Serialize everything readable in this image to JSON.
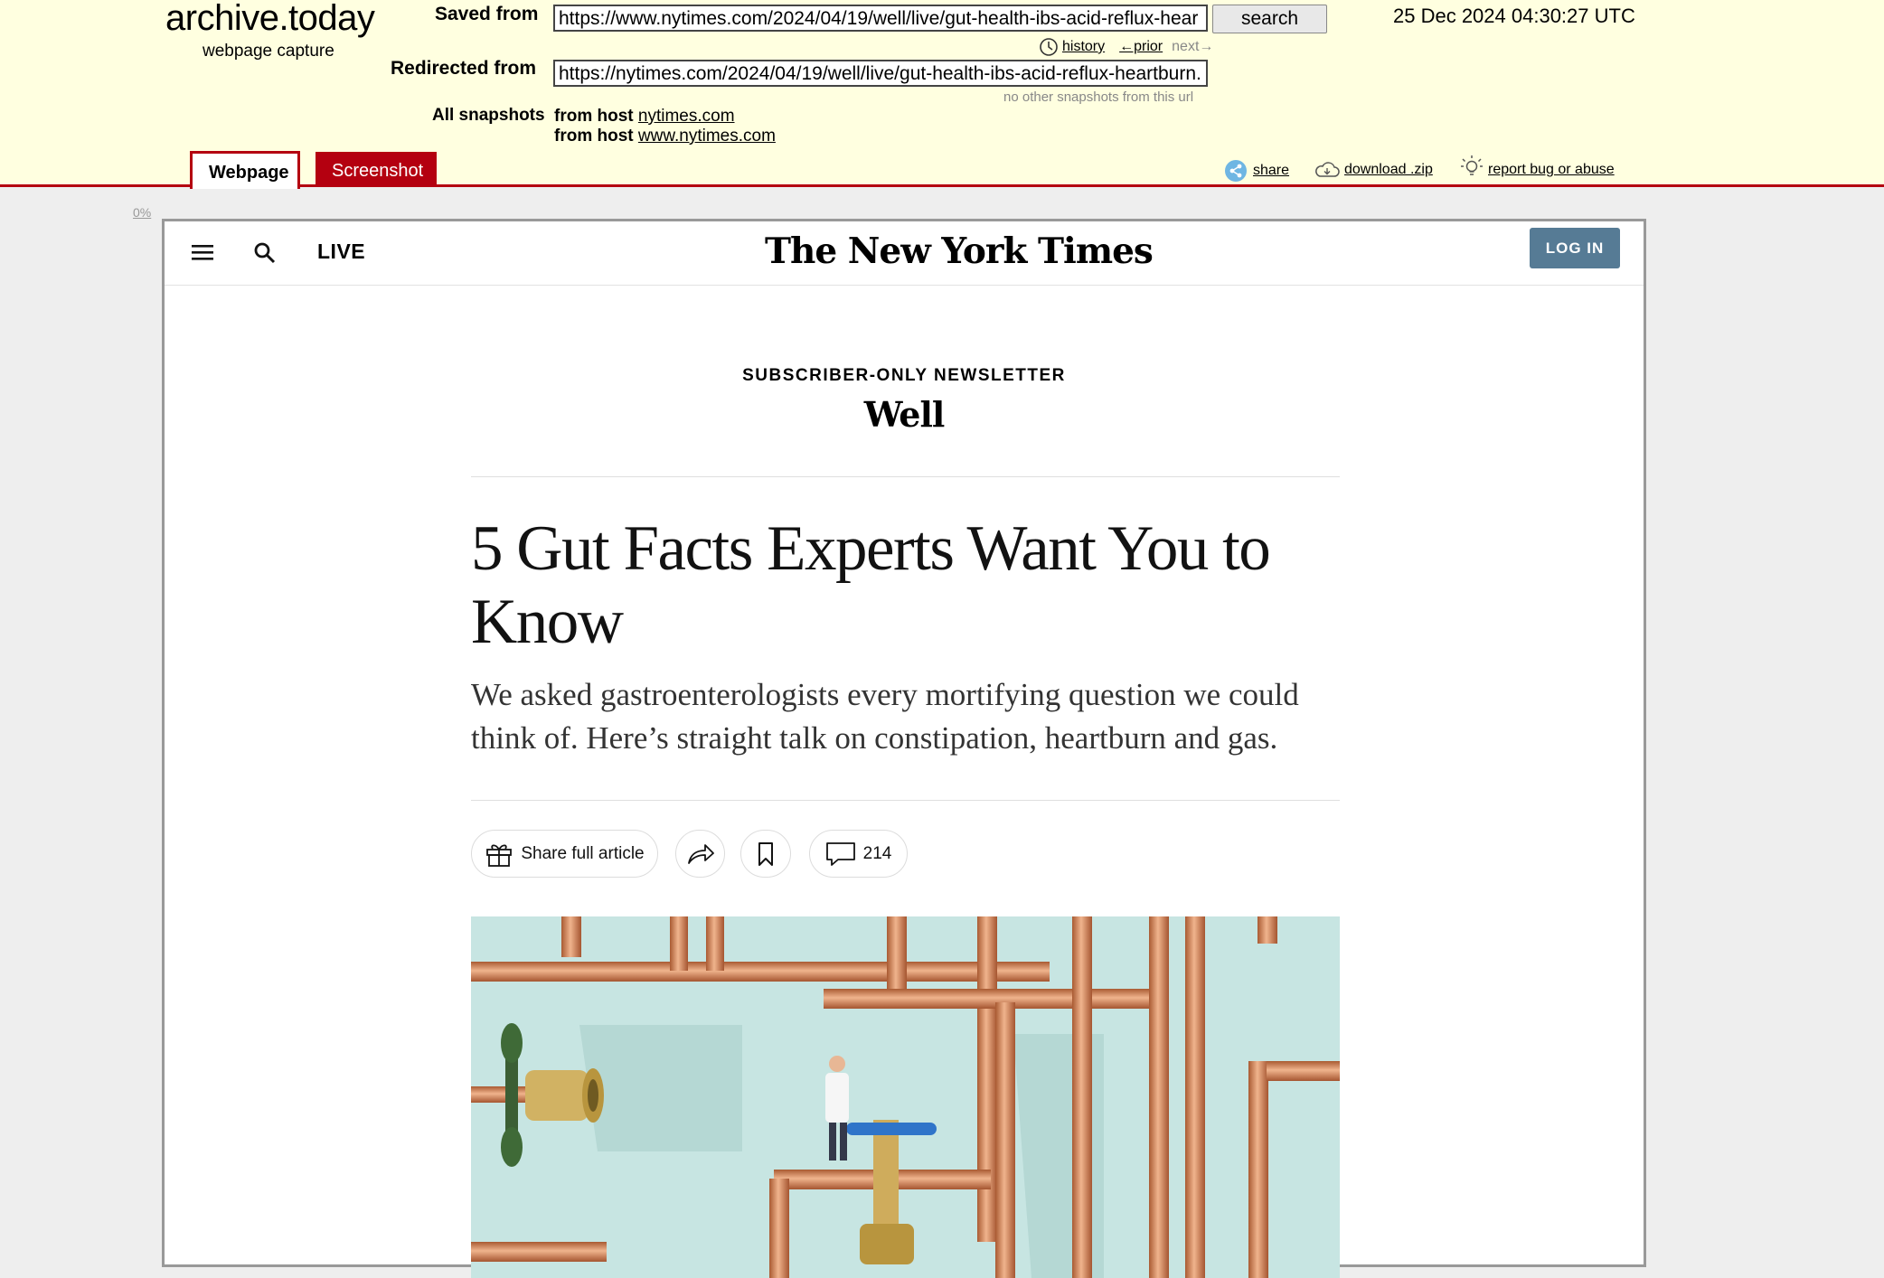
{
  "archive": {
    "logo_title": "archive.today",
    "logo_subtitle": "webpage capture",
    "saved_from_label": "Saved from",
    "saved_from_url": "https://www.nytimes.com/2024/04/19/well/live/gut-health-ibs-acid-reflux-hear",
    "search_label": "search",
    "timestamp": "25 Dec 2024 04:30:27 UTC",
    "history_link": "history",
    "prior_link": "←prior",
    "next_link": "next→",
    "redirected_from_label": "Redirected from",
    "redirected_from_url": "https://nytimes.com/2024/04/19/well/live/gut-health-ibs-acid-reflux-heartburn.",
    "no_other_snapshots": "no other snapshots from this url",
    "all_snapshots_label": "All snapshots",
    "hosts": [
      {
        "prefix": "from host",
        "host": "nytimes.com"
      },
      {
        "prefix": "from host",
        "host": "www.nytimes.com"
      }
    ],
    "tabs": {
      "webpage": "Webpage",
      "screenshot": "Screenshot"
    },
    "tools": {
      "share": "share",
      "download": "download .zip",
      "report": "report bug or abuse"
    },
    "scroll_percent": "0%"
  },
  "nyt": {
    "live_label": "LIVE",
    "logo": "The New York Times",
    "login_label": "LOG IN",
    "kicker": "SUBSCRIBER-ONLY NEWSLETTER",
    "column_name": "Well",
    "headline": "5 Gut Facts Experts Want You to Know",
    "summary": "We asked gastroenterologists every mortifying question we could think of. Here’s straight talk on constipation, heartburn and gas.",
    "share_full_label": "Share full article",
    "comment_count": "214"
  },
  "colors": {
    "archive_bg": "#ffffe0",
    "archive_red": "#b40010",
    "login_blue": "#567b95",
    "image_bg": "#c7e5e2",
    "copper": "#c9794b"
  }
}
